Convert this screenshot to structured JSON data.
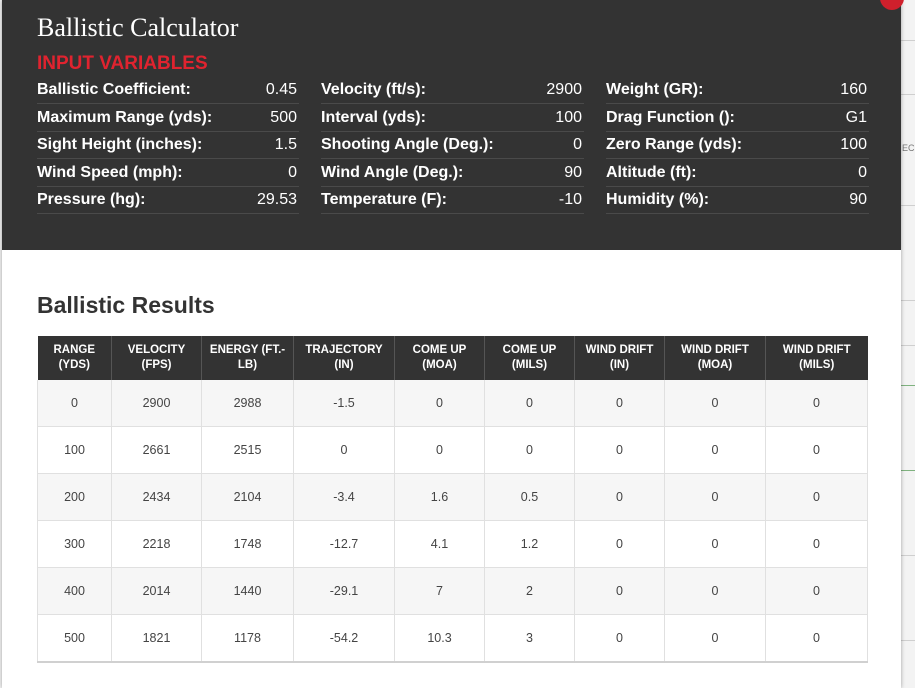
{
  "header": {
    "title": "Ballistic Calculator",
    "section_label": "INPUT VARIABLES"
  },
  "inputs": [
    [
      {
        "label": "Ballistic Coefficient:",
        "value": "0.45"
      },
      {
        "label": "Maximum Range (yds):",
        "value": "500"
      },
      {
        "label": "Sight Height (inches):",
        "value": "1.5"
      },
      {
        "label": "Wind Speed (mph):",
        "value": "0"
      },
      {
        "label": "Pressure (hg):",
        "value": "29.53"
      }
    ],
    [
      {
        "label": "Velocity (ft/s):",
        "value": "2900"
      },
      {
        "label": "Interval (yds):",
        "value": "100"
      },
      {
        "label": "Shooting Angle (Deg.):",
        "value": "0"
      },
      {
        "label": "Wind Angle (Deg.):",
        "value": "90"
      },
      {
        "label": "Temperature (F):",
        "value": "-10"
      }
    ],
    [
      {
        "label": "Weight (GR):",
        "value": "160"
      },
      {
        "label": "Drag Function ():",
        "value": "G1"
      },
      {
        "label": "Zero Range (yds):",
        "value": "100"
      },
      {
        "label": "Altitude (ft):",
        "value": "0"
      },
      {
        "label": "Humidity (%):",
        "value": "90"
      }
    ]
  ],
  "results": {
    "title": "Ballistic Results",
    "columns": [
      "RANGE (YDS)",
      "VELOCITY (FPS)",
      "ENERGY (FT.-LB)",
      "TRAJECTORY (IN)",
      "COME UP (MOA)",
      "COME UP (MILS)",
      "WIND DRIFT (IN)",
      "WIND DRIFT (MOA)",
      "WIND DRIFT (MILS)"
    ],
    "rows": [
      [
        "0",
        "2900",
        "2988",
        "-1.5",
        "0",
        "0",
        "0",
        "0",
        "0"
      ],
      [
        "100",
        "2661",
        "2515",
        "0",
        "0",
        "0",
        "0",
        "0",
        "0"
      ],
      [
        "200",
        "2434",
        "2104",
        "-3.4",
        "1.6",
        "0.5",
        "0",
        "0",
        "0"
      ],
      [
        "300",
        "2218",
        "1748",
        "-12.7",
        "4.1",
        "1.2",
        "0",
        "0",
        "0"
      ],
      [
        "400",
        "2014",
        "1440",
        "-29.1",
        "7",
        "2",
        "0",
        "0",
        "0"
      ],
      [
        "500",
        "1821",
        "1178",
        "-54.2",
        "10.3",
        "3",
        "0",
        "0",
        "0"
      ]
    ]
  },
  "background": {
    "edge_text": "EC"
  },
  "colors": {
    "header_bg": "#333333",
    "accent_red": "#e0232f",
    "table_header_bg": "#333333",
    "row_alt_bg": "#f6f6f6"
  }
}
